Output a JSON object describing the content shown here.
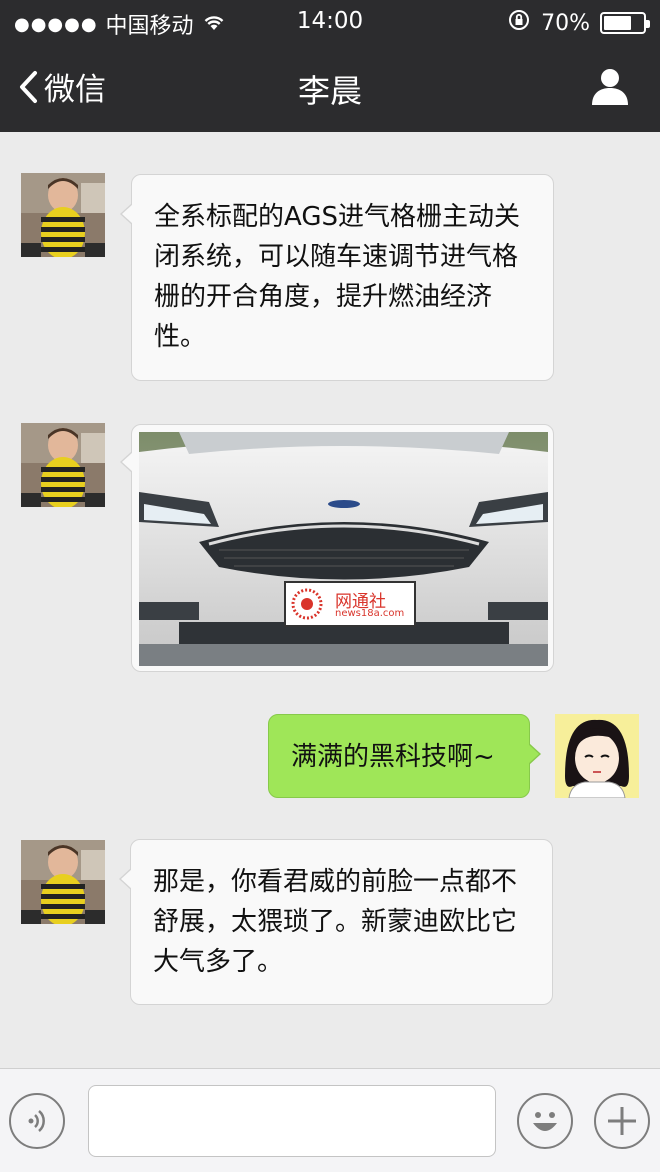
{
  "status_bar": {
    "signal": "●●●●●",
    "carrier": "中国移动",
    "time": "14:00",
    "battery_percent": "70%",
    "battery_level": 0.7
  },
  "nav": {
    "back_label": "微信",
    "title": "李晨"
  },
  "messages": [
    {
      "side": "left",
      "type": "text",
      "text": "全系标配的AGS进气格栅主动关闭系统，可以随车速调节进气格栅的开合角度，提升燃油经济性。"
    },
    {
      "side": "left",
      "type": "image",
      "watermark_name": "网通社",
      "watermark_url": "news18a.com"
    },
    {
      "side": "right",
      "type": "text",
      "text": "满满的黑科技啊~"
    },
    {
      "side": "left",
      "type": "text",
      "text": "那是，你看君威的前脸一点都不舒展，太猥琐了。新蒙迪欧比它大气多了。"
    }
  ],
  "input_bar": {
    "voice_icon": "voice-icon",
    "emoji_icon": "emoji-icon",
    "plus_icon": "plus-icon",
    "text_value": ""
  },
  "colors": {
    "nav_bg": "#2c2c2e",
    "chat_bg": "#ebebeb",
    "bubble_left": "#f9f9f9",
    "bubble_right": "#9fe658"
  }
}
